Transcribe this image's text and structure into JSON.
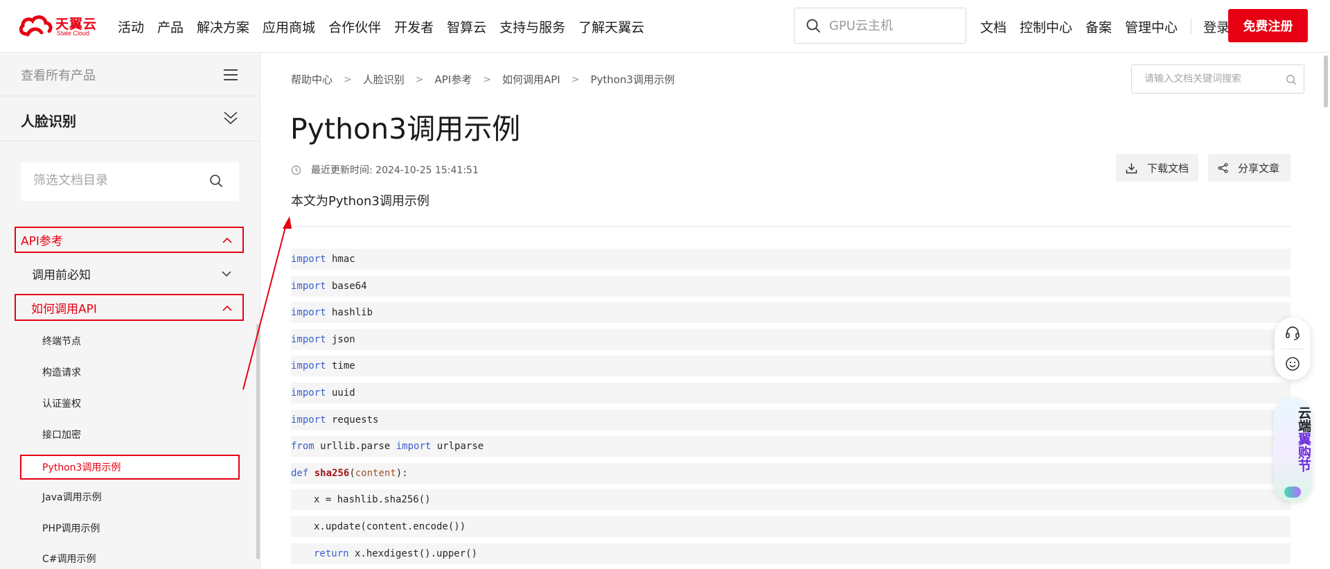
{
  "brand": {
    "name_cn": "天翼云",
    "name_en": "State Cloud",
    "accent": "#e60012"
  },
  "nav": {
    "items": [
      "活动",
      "产品",
      "解决方案",
      "应用商城",
      "合作伙伴",
      "开发者",
      "智算云",
      "支持与服务",
      "了解天翼云"
    ],
    "search_placeholder": "GPU云主机",
    "right_items": [
      "文档",
      "控制中心",
      "备案",
      "管理中心"
    ],
    "login": "登录",
    "register": "免费注册"
  },
  "sidebar": {
    "all_products": "查看所有产品",
    "product": "人脸识别",
    "filter_placeholder": "筛选文档目录",
    "tree": [
      {
        "label": "API参考",
        "level": 0,
        "state": "expanded",
        "active": true
      },
      {
        "label": "调用前必知",
        "level": 1,
        "state": "collapsed",
        "active": false
      },
      {
        "label": "如何调用API",
        "level": 1,
        "state": "expanded",
        "active": true
      },
      {
        "label": "终端节点",
        "level": 2
      },
      {
        "label": "构造请求",
        "level": 2
      },
      {
        "label": "认证鉴权",
        "level": 2
      },
      {
        "label": "接口加密",
        "level": 2
      },
      {
        "label": "Python3调用示例",
        "level": 2,
        "active": true
      },
      {
        "label": "Java调用示例",
        "level": 2
      },
      {
        "label": "PHP调用示例",
        "level": 2
      },
      {
        "label": "C#调用示例",
        "level": 2
      }
    ]
  },
  "content": {
    "breadcrumb": [
      "帮助中心",
      "人脸识别",
      "API参考",
      "如何调用API",
      "Python3调用示例"
    ],
    "doc_search_placeholder": "请输入文档关键词搜索",
    "title": "Python3调用示例",
    "updated_label": "最近更新时间: 2024-10-25 15:41:51",
    "download": "下载文档",
    "share": "分享文章",
    "intro": "本文为Python3调用示例",
    "code": [
      {
        "indent": 0,
        "tokens": [
          [
            "kw",
            "import"
          ],
          [
            "t",
            " hmac"
          ]
        ]
      },
      {
        "indent": 0,
        "tokens": [
          [
            "kw",
            "import"
          ],
          [
            "t",
            " base64"
          ]
        ]
      },
      {
        "indent": 0,
        "tokens": [
          [
            "kw",
            "import"
          ],
          [
            "t",
            " hashlib"
          ]
        ]
      },
      {
        "indent": 0,
        "tokens": [
          [
            "kw",
            "import"
          ],
          [
            "t",
            " json"
          ]
        ]
      },
      {
        "indent": 0,
        "tokens": [
          [
            "kw",
            "import"
          ],
          [
            "t",
            " time"
          ]
        ]
      },
      {
        "indent": 0,
        "tokens": [
          [
            "kw",
            "import"
          ],
          [
            "t",
            " uuid"
          ]
        ]
      },
      {
        "indent": 0,
        "tokens": [
          [
            "kw",
            "import"
          ],
          [
            "t",
            " requests"
          ]
        ]
      },
      {
        "indent": 0,
        "tokens": [
          [
            "kw",
            "from"
          ],
          [
            "t",
            " urllib.parse "
          ],
          [
            "kw",
            "import"
          ],
          [
            "t",
            " urlparse"
          ]
        ]
      },
      {
        "indent": 0,
        "tokens": [
          [
            "kw",
            "def"
          ],
          [
            "t",
            " "
          ],
          [
            "fn",
            "sha256"
          ],
          [
            "t",
            "("
          ],
          [
            "prm",
            "content"
          ],
          [
            "t",
            "):"
          ]
        ]
      },
      {
        "indent": 1,
        "tokens": [
          [
            "t",
            "x = hashlib.sha256()"
          ]
        ]
      },
      {
        "indent": 1,
        "tokens": [
          [
            "t",
            "x.update(content.encode())"
          ]
        ]
      },
      {
        "indent": 1,
        "tokens": [
          [
            "kw",
            "return"
          ],
          [
            "t",
            " x.hexdigest().upper()"
          ]
        ]
      }
    ]
  },
  "promo": {
    "line1": "云端",
    "line2": "翼购",
    "line3": "节"
  },
  "icons": {
    "search": "search-icon",
    "menu": "menu-icon",
    "double_chevron": "double-chevron-down-icon",
    "chevron_up": "chevron-up-icon",
    "chevron_down": "chevron-down-icon",
    "clock": "clock-icon",
    "download": "download-icon",
    "share": "share-icon",
    "headset": "headset-icon",
    "smile": "smile-icon"
  }
}
